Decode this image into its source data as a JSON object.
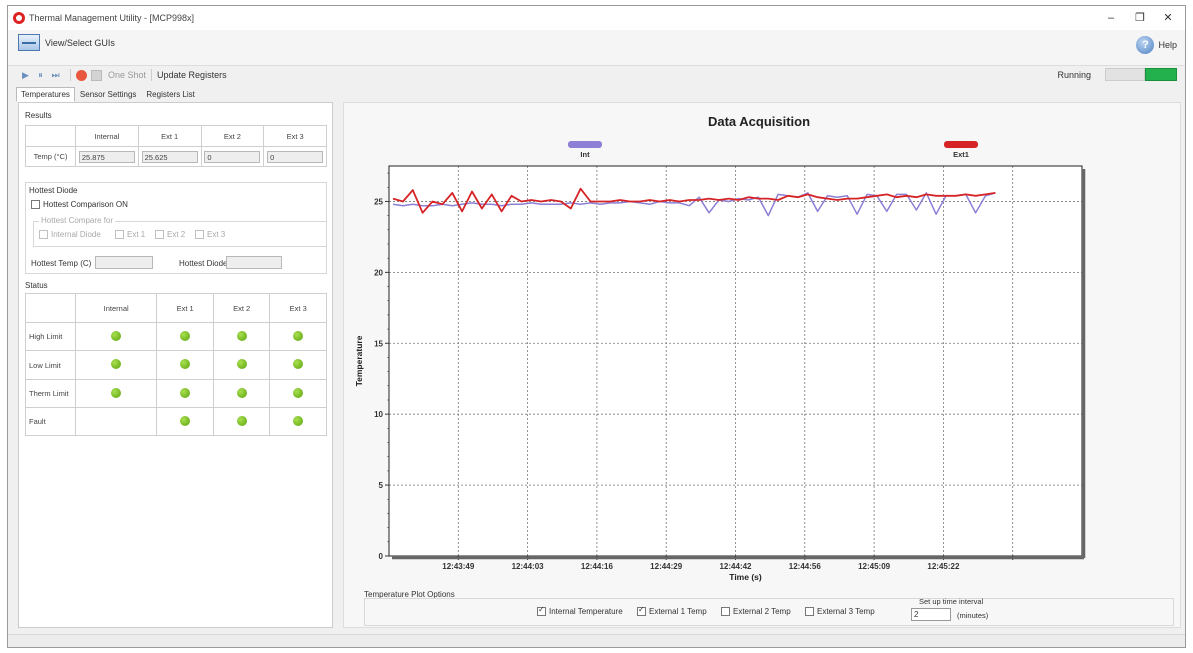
{
  "window": {
    "title": "Thermal Management Utility - [MCP998x]",
    "minimize_glyph": "–",
    "maximize_glyph": "❐",
    "close_glyph": "✕"
  },
  "menubar": {
    "view_select_label": "View/Select GUIs",
    "help_label": "Help",
    "help_glyph": "?"
  },
  "toolbar": {
    "play_icon": "▶",
    "pause_icon": "⏸",
    "skip_icon": "⏭",
    "one_shot_label": "One Shot",
    "update_registers_label": "Update Registers",
    "running_label": "Running",
    "running_level": 1.0,
    "running_color": "#22b14c"
  },
  "tabs": [
    {
      "label": "Temperatures",
      "active": true
    },
    {
      "label": "Sensor Settings",
      "active": false
    },
    {
      "label": "Registers List",
      "active": false
    }
  ],
  "results": {
    "title": "Results",
    "headers": [
      "",
      "Internal",
      "Ext 1",
      "Ext 2",
      "Ext 3"
    ],
    "row_label": "Temp (°C)",
    "values": [
      "25.875",
      "25.625",
      "0",
      "0"
    ]
  },
  "hottest": {
    "title": "Hottest Diode",
    "comparison_label": "Hottest Comparison ON",
    "compare_for_label": "Hottest Compare for",
    "options": [
      "Internal Diode",
      "Ext 1",
      "Ext 2",
      "Ext 3"
    ],
    "temp_label": "Hottest Temp (C)",
    "diode_label": "Hottest Diode"
  },
  "status": {
    "title": "Status",
    "headers": [
      "",
      "Internal",
      "Ext 1",
      "Ext 2",
      "Ext 3"
    ],
    "rows": [
      {
        "label": "High Limit",
        "leds": [
          true,
          true,
          true,
          true
        ]
      },
      {
        "label": "Low Limit",
        "leds": [
          true,
          true,
          true,
          true
        ]
      },
      {
        "label": "Therm Limit",
        "leds": [
          true,
          true,
          true,
          true
        ]
      },
      {
        "label": "Fault",
        "leds": [
          false,
          true,
          true,
          true
        ]
      }
    ],
    "led_color": "#6cbb1e"
  },
  "plot_options": {
    "title": "Temperature Plot Options",
    "checks": [
      {
        "label": "Internal Temperature",
        "checked": true
      },
      {
        "label": "External 1 Temp",
        "checked": true
      },
      {
        "label": "External 2 Temp",
        "checked": false
      },
      {
        "label": "External 3 Temp",
        "checked": false
      }
    ],
    "interval_label": "Set up time interval",
    "interval_value": "2",
    "interval_unit": "(minutes)"
  },
  "chart_data": {
    "type": "line",
    "title": "Data Acquisition",
    "xlabel": "Time (s)",
    "ylabel": "Temperature",
    "ylim": [
      0,
      27.5
    ],
    "yticks": [
      0,
      5,
      10,
      15,
      20,
      25
    ],
    "xticks": [
      "12:43:49",
      "12:44:03",
      "12:44:16",
      "12:44:29",
      "12:44:42",
      "12:44:56",
      "12:45:09",
      "12:45:22"
    ],
    "grid": true,
    "series": [
      {
        "name": "Int",
        "color": "#8b7fd6",
        "values": [
          24.8,
          24.7,
          24.8,
          24.7,
          24.7,
          24.8,
          24.7,
          24.8,
          24.9,
          24.8,
          24.8,
          24.7,
          24.8,
          24.8,
          24.9,
          24.8,
          24.8,
          24.8,
          24.9,
          24.8,
          24.9,
          24.8,
          24.9,
          24.9,
          25.0,
          24.9,
          24.8,
          25.0,
          24.9,
          24.9,
          24.7,
          25.3,
          24.2,
          25.1,
          25.0,
          25.2,
          25.1,
          25.3,
          24.0,
          25.5,
          25.4,
          25.3,
          25.6,
          24.3,
          25.4,
          25.3,
          25.4,
          24.1,
          25.5,
          25.4,
          24.3,
          25.5,
          25.5,
          24.4,
          25.6,
          24.1,
          25.4,
          25.4,
          25.5,
          24.2,
          25.4,
          25.6
        ]
      },
      {
        "name": "Ext1",
        "color": "#d62426",
        "values": [
          25.2,
          25.0,
          25.8,
          24.2,
          25.0,
          24.8,
          25.6,
          24.3,
          25.7,
          24.5,
          25.5,
          24.3,
          25.4,
          25.0,
          25.1,
          25.0,
          25.1,
          25.0,
          24.5,
          25.9,
          25.0,
          25.0,
          25.0,
          25.1,
          25.0,
          25.0,
          25.1,
          25.0,
          25.1,
          25.0,
          25.1,
          25.1,
          25.2,
          25.1,
          25.2,
          25.1,
          25.3,
          25.2,
          25.2,
          25.1,
          25.4,
          25.3,
          25.5,
          25.3,
          25.2,
          25.1,
          25.2,
          25.2,
          25.3,
          25.4,
          25.5,
          25.3,
          25.4,
          25.3,
          25.5,
          25.4,
          25.4,
          25.4,
          25.5,
          25.4,
          25.5,
          25.6
        ]
      }
    ]
  }
}
